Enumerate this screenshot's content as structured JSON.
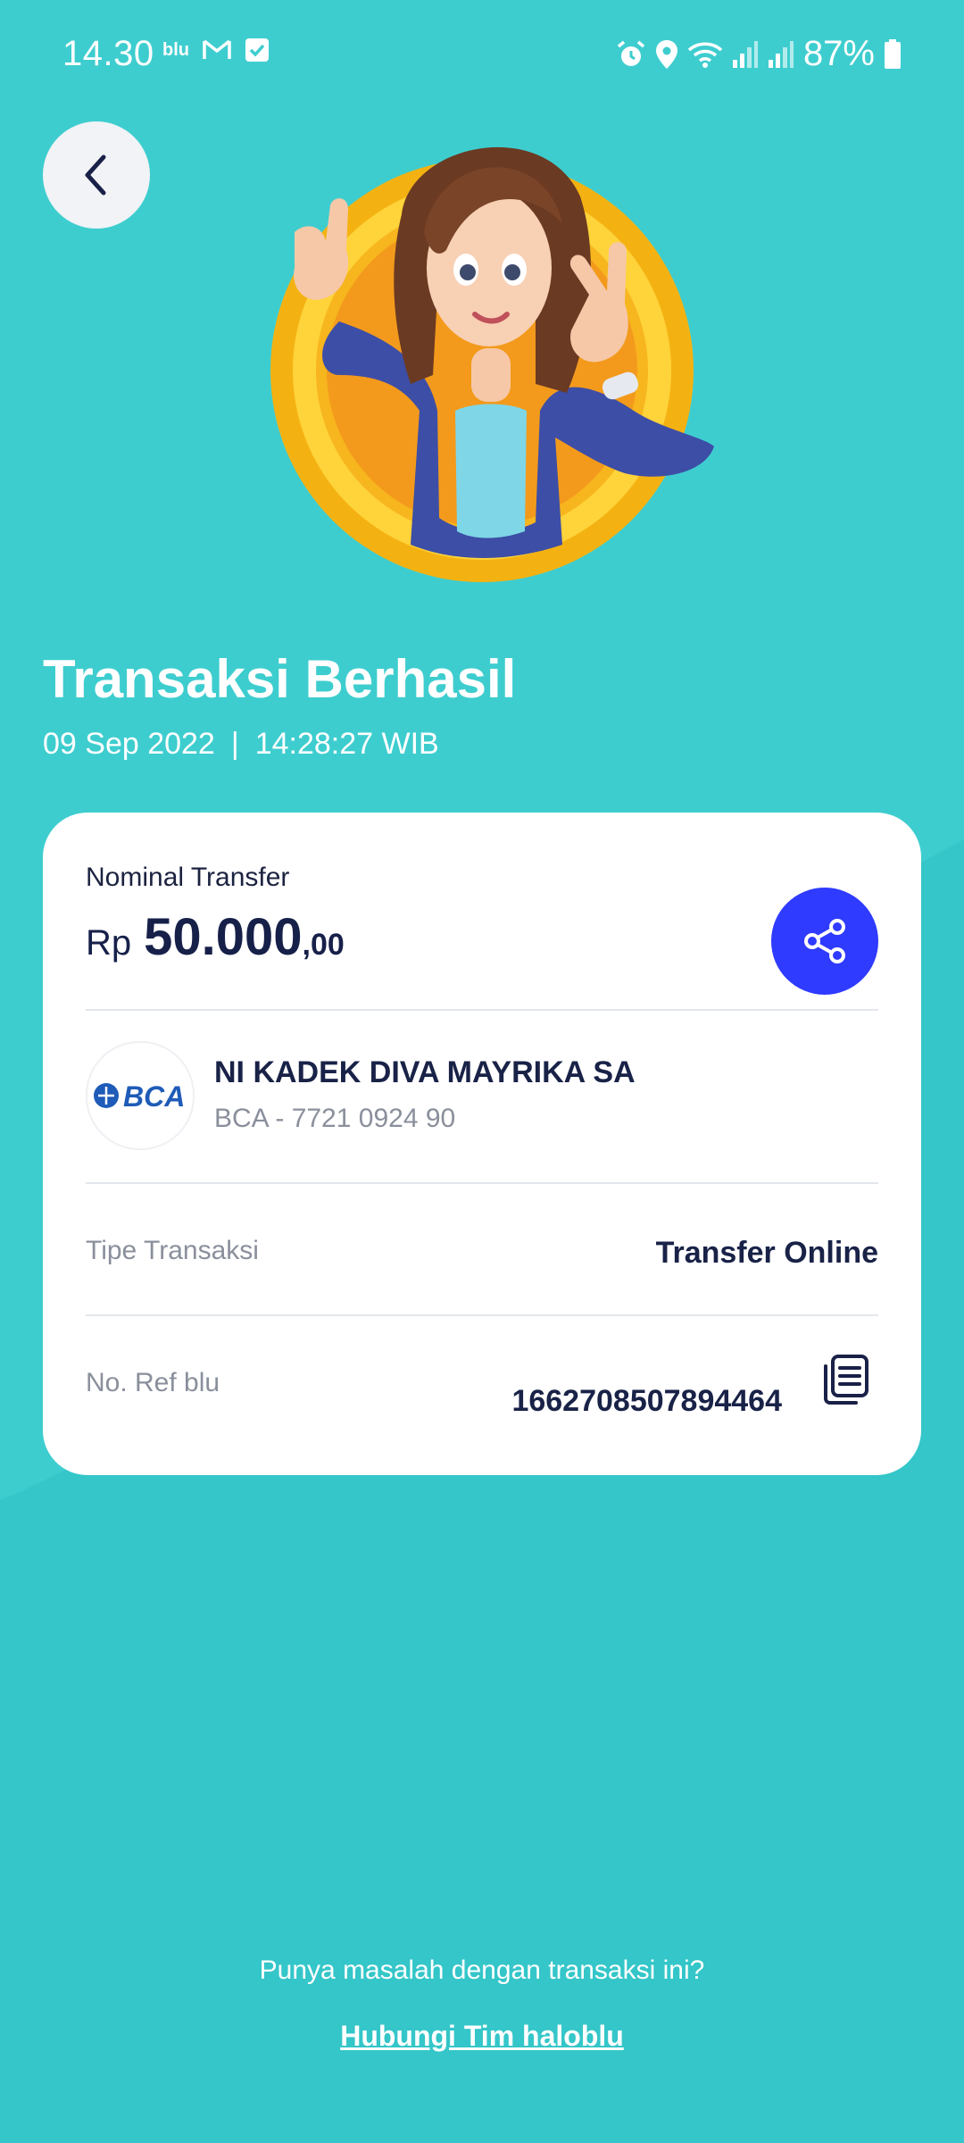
{
  "status_bar": {
    "time": "14.30",
    "app_badge": "blu",
    "battery": "87%",
    "icons": [
      "gmail-icon",
      "checkbox-icon",
      "alarm-icon",
      "location-icon",
      "wifi-icon",
      "signal-icon",
      "battery-icon"
    ]
  },
  "header": {
    "back_icon": "chevron-left-icon"
  },
  "result": {
    "title": "Transaksi Berhasil",
    "date": "09 Sep 2022",
    "separator": "|",
    "time": "14:28:27 WIB"
  },
  "card": {
    "nominal_label": "Nominal Transfer",
    "currency": "Rp",
    "amount_main": "50.000",
    "amount_decimal": ",00",
    "share_icon": "share-icon",
    "bank_logo_text": "BCA",
    "recipient_name": "NI KADEK DIVA MAYRIKA SA",
    "recipient_account": "BCA - 7721 0924 90",
    "type_label": "Tipe Transaksi",
    "type_value": "Transfer Online",
    "ref_label": "No. Ref blu",
    "ref_value": "1662708507894464",
    "copy_icon": "copy-icon"
  },
  "footer": {
    "question": "Punya masalah dengan transaksi ini?",
    "link": "Hubungi Tim haloblu"
  },
  "colors": {
    "background": "#3ecdcf",
    "card": "#ffffff",
    "share_button": "#2f3bff",
    "text_dark": "#192247",
    "text_muted": "#8a8f9c",
    "bca_blue": "#1f5bb8"
  }
}
